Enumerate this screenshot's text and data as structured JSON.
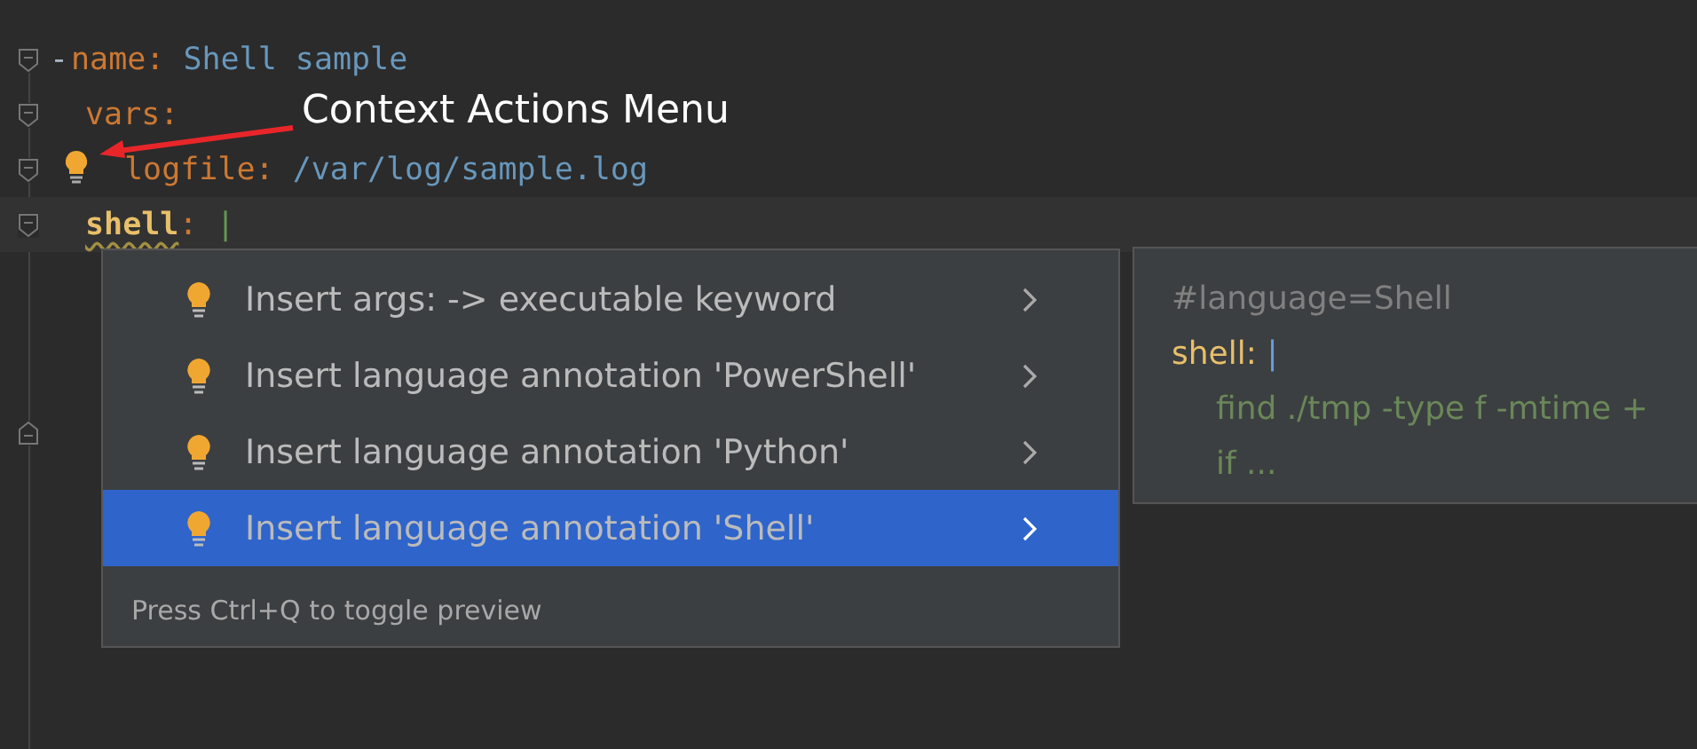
{
  "code_lines": [
    {
      "dash": "-",
      "key": "name",
      "sep": ":",
      "value": "Shell sample",
      "bulb": false,
      "current": false
    },
    {
      "key": "vars",
      "sep": ":",
      "bulb": false,
      "current": false,
      "children": [
        {
          "key": "logfile",
          "sep": ":",
          "value": "/var/log/sample.log",
          "bulb": true,
          "current": false
        }
      ]
    },
    {
      "key": "shell",
      "sep": ":",
      "value": "|",
      "bulb": false,
      "current": true
    }
  ],
  "annotation": {
    "label": "Context Actions Menu"
  },
  "context_menu": {
    "items": [
      {
        "label": "Insert args: -> executable keyword",
        "selected": false
      },
      {
        "label": "Insert language annotation 'PowerShell'",
        "selected": false
      },
      {
        "label": "Insert language annotation 'Python'",
        "selected": false
      },
      {
        "label": "Insert language annotation 'Shell'",
        "selected": true
      }
    ],
    "hint": "Press Ctrl+Q to toggle preview"
  },
  "preview": {
    "lines": [
      {
        "kind": "comment",
        "text": "#language=Shell"
      },
      {
        "kind": "key",
        "key": "shell",
        "sep": ":",
        "value": "|"
      },
      {
        "kind": "code",
        "text": "find ./tmp -type f -mtime +"
      },
      {
        "kind": "code",
        "text": "if ..."
      }
    ]
  }
}
